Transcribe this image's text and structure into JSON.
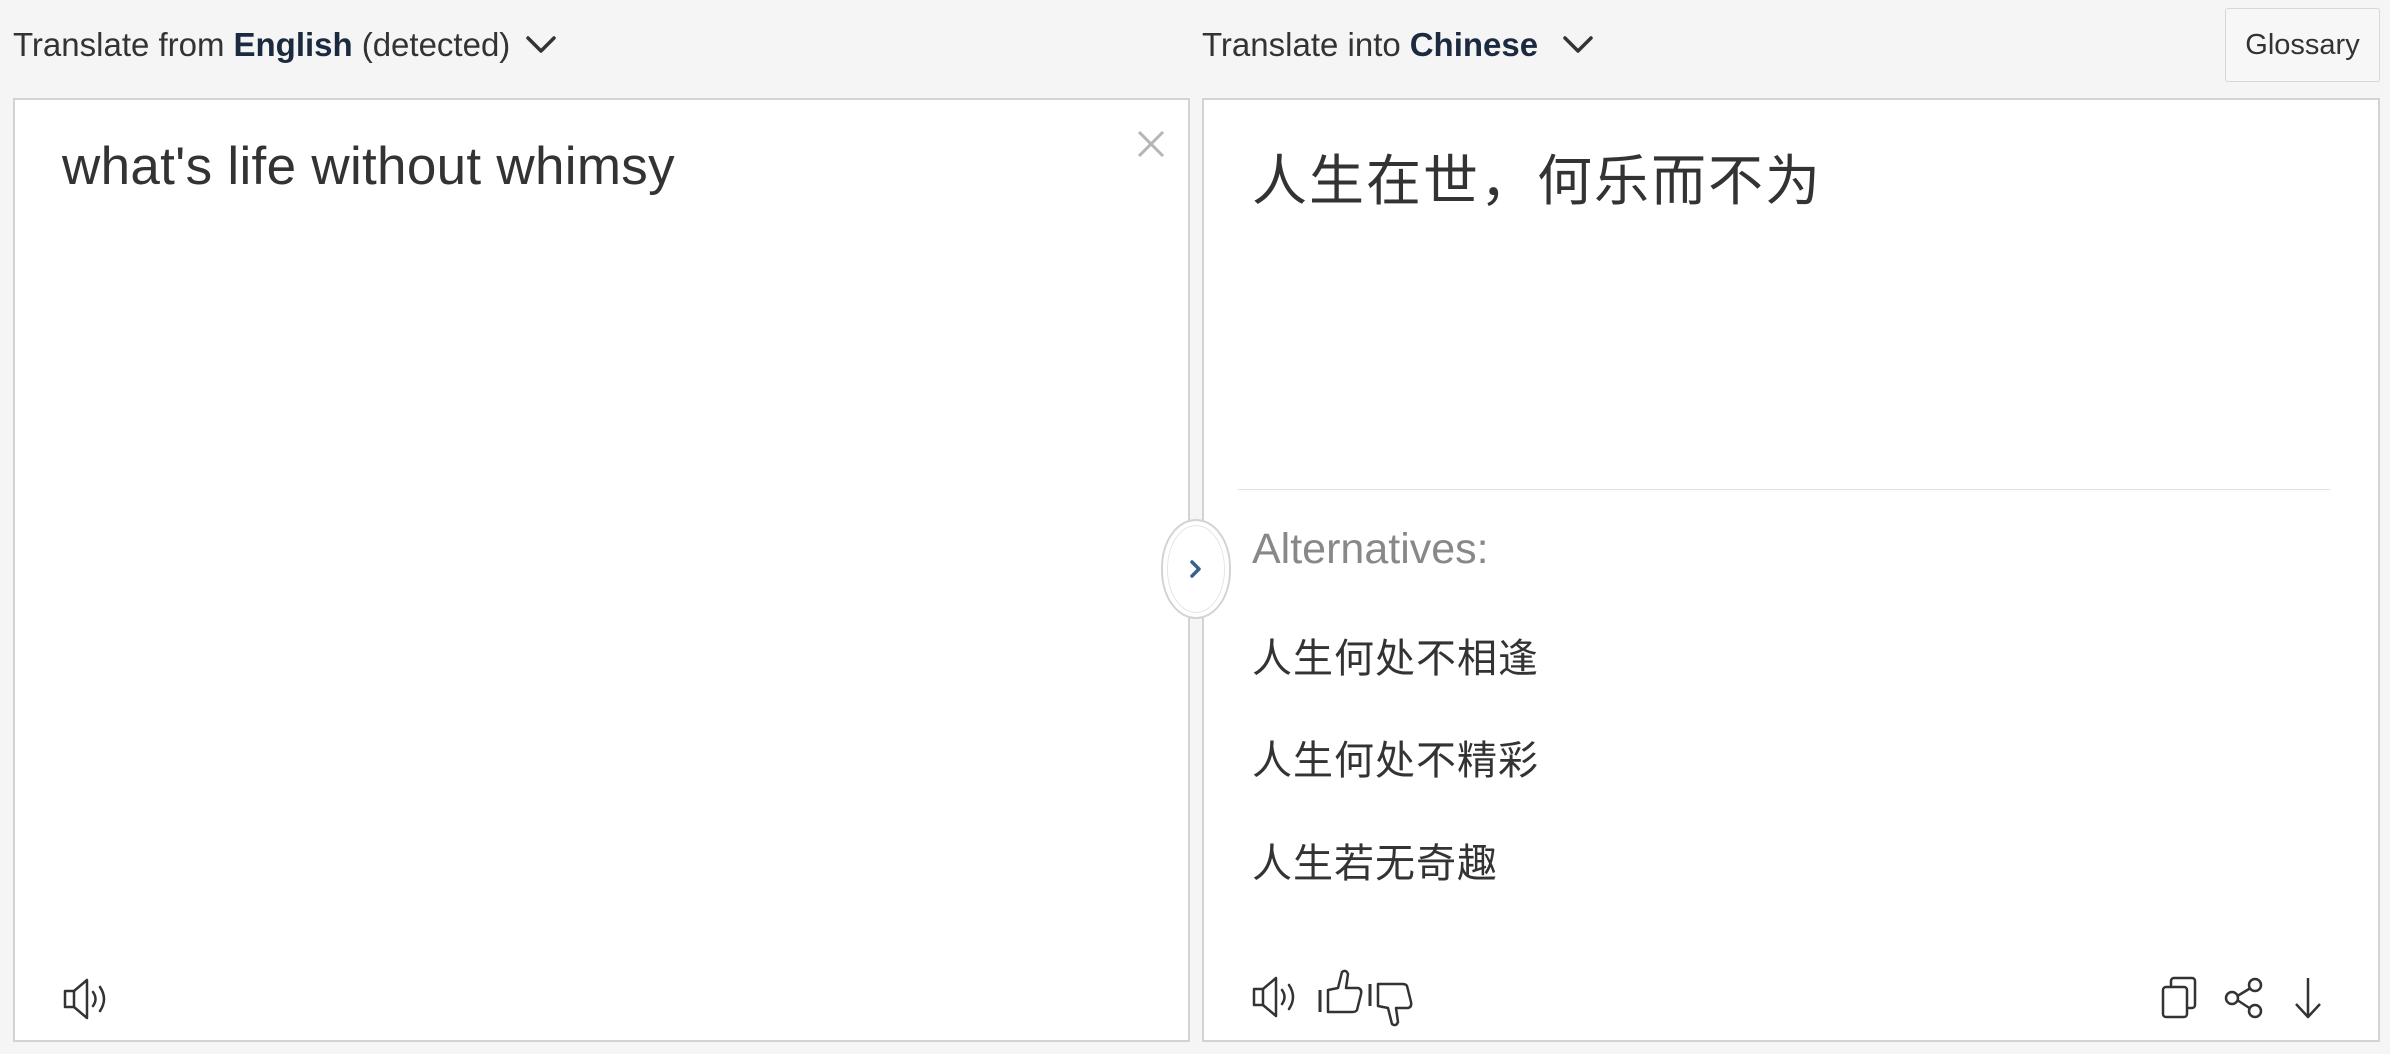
{
  "source_lang": {
    "prefix": "Translate from",
    "language": "English",
    "suffix": "(detected)"
  },
  "target_lang": {
    "prefix": "Translate into",
    "language": "Chinese"
  },
  "glossary_label": "Glossary",
  "source": {
    "text": "what's life without whimsy"
  },
  "target": {
    "text": "人生在世，何乐而不为",
    "alternatives_title": "Alternatives:",
    "alternatives": [
      "人生何处不相逢",
      "人生何处不精彩",
      "人生若无奇趣"
    ]
  },
  "icons": {
    "chevron": "chevron-down-icon",
    "clear": "close-icon",
    "speaker": "speaker-icon",
    "thumb_up": "thumbs-up-icon",
    "thumb_down": "thumbs-down-icon",
    "copy": "copy-icon",
    "share": "share-icon",
    "download": "arrow-down-icon",
    "swap": "chevron-right-icon"
  },
  "colors": {
    "language_bold": "#1b2a3f",
    "swap_arrow": "#3a5f8a",
    "alt_title": "#888888"
  }
}
